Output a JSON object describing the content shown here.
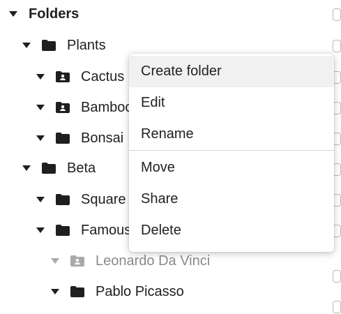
{
  "tree": {
    "root": {
      "label": "Folders"
    },
    "items": [
      {
        "label": "Plants",
        "type": "folder",
        "level": 1
      },
      {
        "label": "Cactus",
        "type": "shared-folder",
        "level": 2
      },
      {
        "label": "Bamboo",
        "type": "shared-folder",
        "level": 2
      },
      {
        "label": "Bonsai",
        "type": "folder",
        "level": 2
      },
      {
        "label": "Beta",
        "type": "folder",
        "level": 1
      },
      {
        "label": "Square",
        "type": "folder",
        "level": 2
      },
      {
        "label": "Famous",
        "type": "folder",
        "level": 2
      },
      {
        "label": "Leonardo Da Vinci",
        "type": "shared-folder",
        "level": 2,
        "state": "disabled"
      },
      {
        "label": "Pablo Picasso",
        "type": "folder",
        "level": 2
      }
    ]
  },
  "context_menu": {
    "items": [
      {
        "label": "Create folder",
        "highlighted": true
      },
      {
        "label": "Edit"
      },
      {
        "label": "Rename"
      },
      {
        "label": "Move"
      },
      {
        "label": "Share"
      },
      {
        "label": "Delete"
      }
    ]
  },
  "colors": {
    "text": "#1f1f1f",
    "muted_text": "#8a8a8a",
    "menu_hover": "#f1f1f1",
    "checkbox_border": "#b9b9b9"
  }
}
